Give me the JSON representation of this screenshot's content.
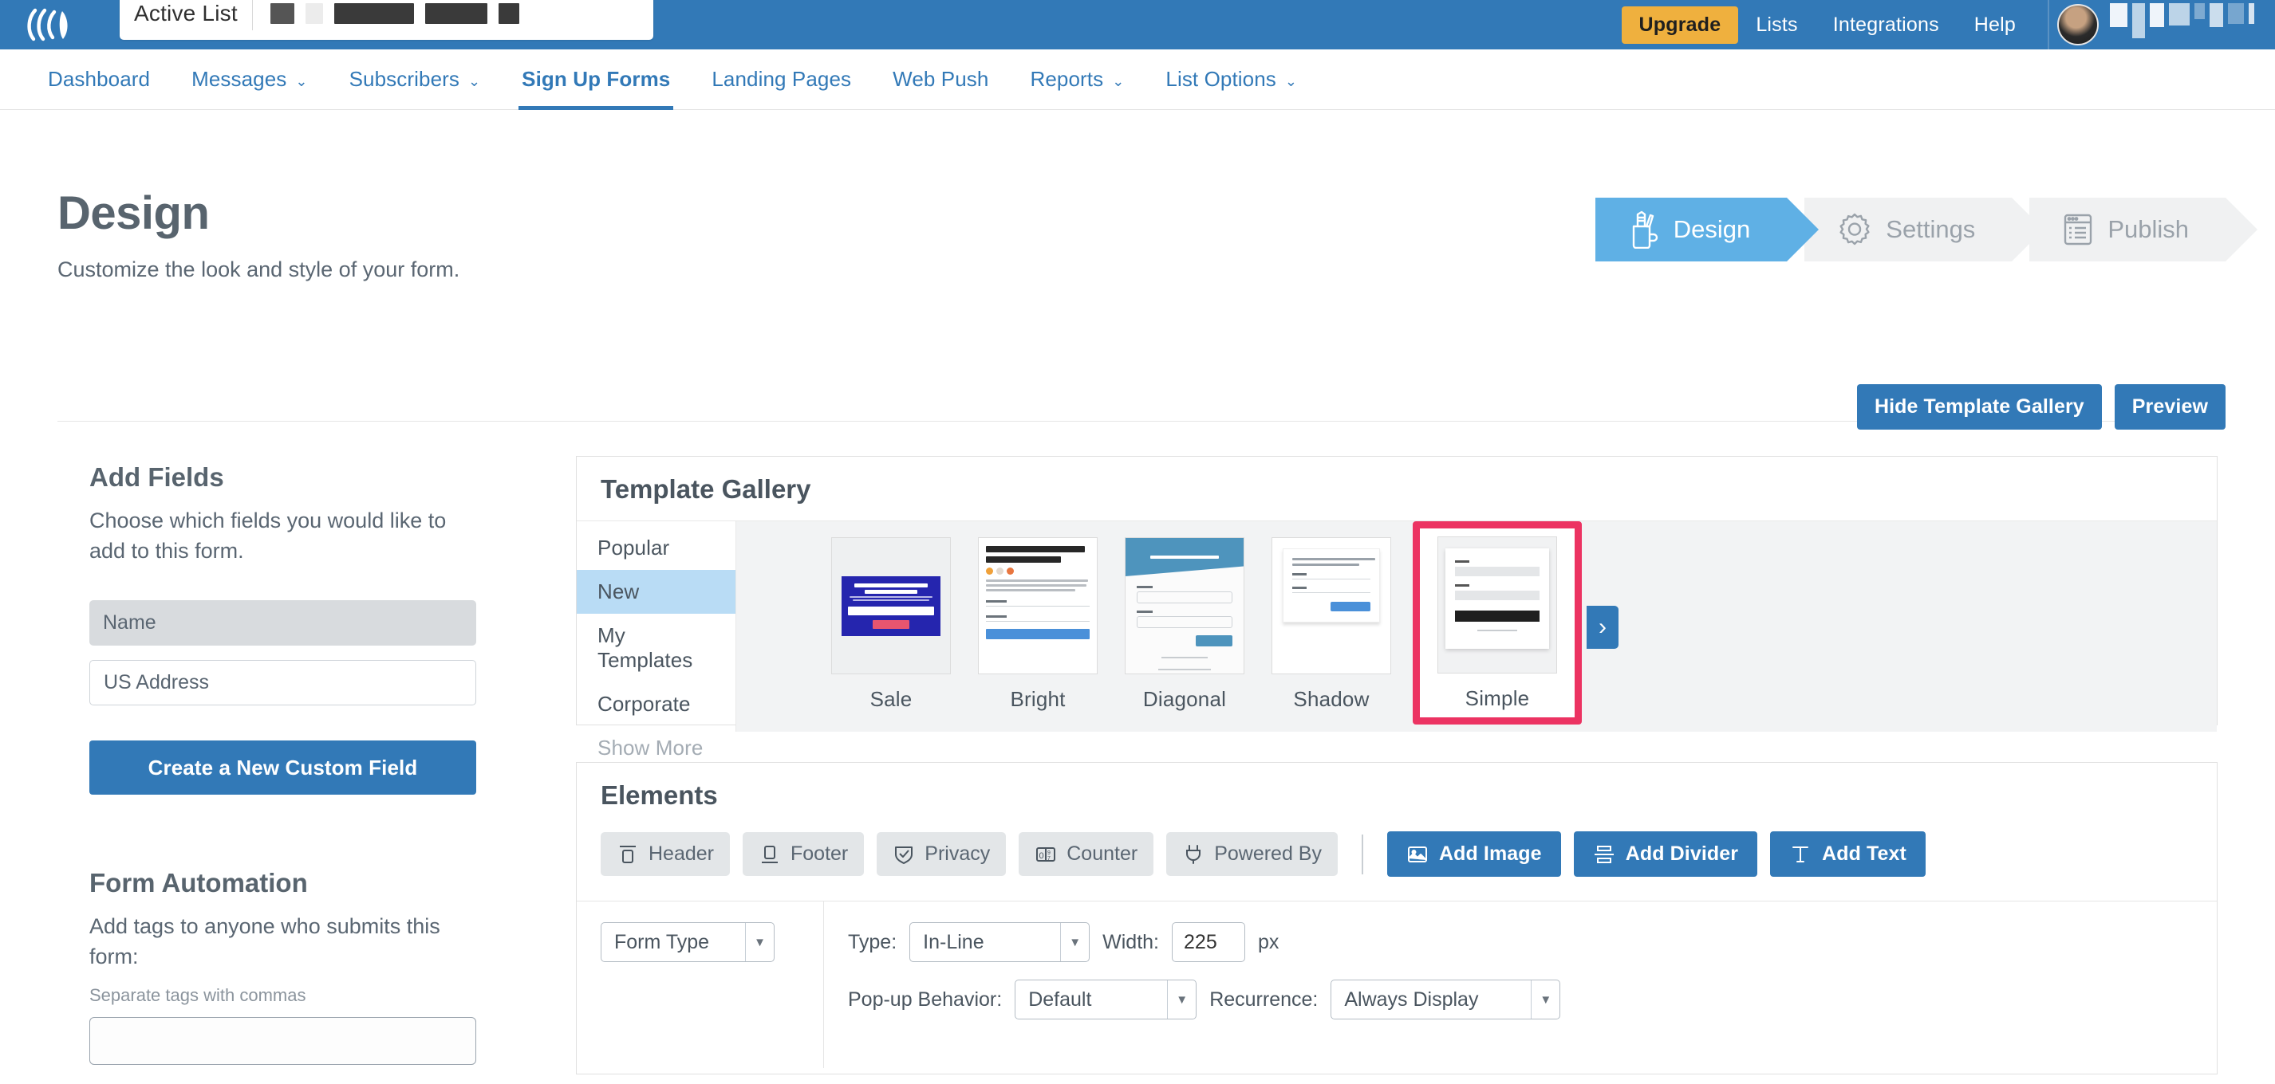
{
  "topbar": {
    "logo_icon": "brand-swoosh-logo",
    "list_picker": {
      "label": "Active List",
      "value_redacted": true
    },
    "upgrade_label": "Upgrade",
    "links": [
      "Lists",
      "Integrations",
      "Help"
    ],
    "account": {
      "avatar_icon": "user-avatar",
      "name_redacted": true
    }
  },
  "mainnav": {
    "items": [
      {
        "label": "Dashboard",
        "has_caret": false,
        "active": false
      },
      {
        "label": "Messages",
        "has_caret": true,
        "active": false
      },
      {
        "label": "Subscribers",
        "has_caret": true,
        "active": false
      },
      {
        "label": "Sign Up Forms",
        "has_caret": false,
        "active": true
      },
      {
        "label": "Landing Pages",
        "has_caret": false,
        "active": false
      },
      {
        "label": "Web Push",
        "has_caret": false,
        "active": false
      },
      {
        "label": "Reports",
        "has_caret": true,
        "active": false
      },
      {
        "label": "List Options",
        "has_caret": true,
        "active": false
      }
    ],
    "caret_glyph": "⌄"
  },
  "page": {
    "title": "Design",
    "subtitle": "Customize the look and style of your form."
  },
  "steps": [
    {
      "label": "Design",
      "icon": "pencil-cup-icon",
      "active": true
    },
    {
      "label": "Settings",
      "icon": "gear-icon",
      "active": false
    },
    {
      "label": "Publish",
      "icon": "browser-list-icon",
      "active": false
    }
  ],
  "top_actions": {
    "hide_gallery_label": "Hide Template Gallery",
    "preview_label": "Preview"
  },
  "sidebar": {
    "add_fields": {
      "heading": "Add Fields",
      "description": "Choose which fields you would like to add to this form.",
      "fields": [
        {
          "label": "Name",
          "state": "selected"
        },
        {
          "label": "US Address",
          "state": "default"
        }
      ],
      "cta_label": "Create a New Custom Field"
    },
    "form_automation": {
      "heading": "Form Automation",
      "description": "Add tags to anyone who submits this form:",
      "hint": "Separate tags with commas",
      "tag_input_value": ""
    }
  },
  "gallery": {
    "title": "Template Gallery",
    "categories": [
      {
        "label": "Popular",
        "selected": false,
        "muted": false
      },
      {
        "label": "New",
        "selected": true,
        "muted": false
      },
      {
        "label": "My Templates",
        "selected": false,
        "muted": false
      },
      {
        "label": "Corporate",
        "selected": false,
        "muted": false
      },
      {
        "label": "Show More",
        "selected": false,
        "muted": true
      }
    ],
    "templates": [
      {
        "label": "Sale",
        "selected": false
      },
      {
        "label": "Bright",
        "selected": false
      },
      {
        "label": "Diagonal",
        "selected": false
      },
      {
        "label": "Shadow",
        "selected": false
      },
      {
        "label": "Simple",
        "selected": true
      }
    ],
    "selection_color": "#ec3362",
    "next_arrow_glyph": "›"
  },
  "elements": {
    "title": "Elements",
    "chips": [
      {
        "label": "Header",
        "icon": "header-bar-icon"
      },
      {
        "label": "Footer",
        "icon": "footer-bar-icon"
      },
      {
        "label": "Privacy",
        "icon": "shield-check-icon"
      },
      {
        "label": "Counter",
        "icon": "odometer-counter-icon"
      },
      {
        "label": "Powered By",
        "icon": "power-plug-icon"
      }
    ],
    "add_buttons": [
      {
        "label": "Add Image",
        "icon": "image-icon"
      },
      {
        "label": "Add Divider",
        "icon": "divider-icon"
      },
      {
        "label": "Add Text",
        "icon": "text-t-icon"
      }
    ],
    "config": {
      "form_type_select": "Form Type",
      "type_label": "Type:",
      "type_value": "In-Line",
      "width_label": "Width:",
      "width_value": "225",
      "width_unit": "px",
      "popup_behavior_label": "Pop-up Behavior:",
      "popup_behavior_value": "Default",
      "recurrence_label": "Recurrence:",
      "recurrence_value": "Always Display"
    }
  },
  "colors": {
    "brand_blue": "#3279b7",
    "accent_light_blue": "#5fb0e5",
    "upgrade_orange": "#efb03e",
    "selection_pink": "#ec3362",
    "text_slate": "#58646e"
  }
}
